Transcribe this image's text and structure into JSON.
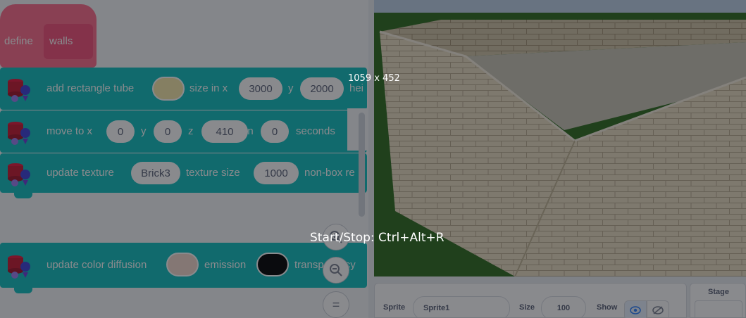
{
  "define_block": {
    "define_label": "define",
    "name_label": "walls"
  },
  "blocks": {
    "tube": {
      "label_add": "add rectangle tube",
      "label_size": "size in x",
      "x_value": "3000",
      "label_y": "y",
      "y_value": "2000",
      "label_tail": "hei",
      "color": "#f7e8a8"
    },
    "move": {
      "label_move": "move to x",
      "x_value": "0",
      "label_y": "y",
      "y_value": "0",
      "label_z": "z",
      "z_value": "410",
      "label_in": "in",
      "secs_value": "0",
      "label_seconds": "seconds"
    },
    "texture": {
      "label_update": "update texture",
      "texture_value": "Brick3",
      "label_size": "texture size",
      "size_value": "1000",
      "label_tail": "non-box re"
    },
    "color": {
      "label_update": "update color diffusion",
      "label_emission": "emission",
      "label_tail": "transparency",
      "diffusion_color": "#f5d8cc",
      "emission_color": "#000000"
    }
  },
  "zoom": {
    "zoom_in_icon": "zoom-in-icon",
    "zoom_out_icon": "zoom-out-icon",
    "reset_icon": "="
  },
  "sprite_panel": {
    "sprite_label": "Sprite",
    "sprite_name": "Sprite1",
    "size_label": "Size",
    "size_value": "100",
    "show_label": "Show"
  },
  "stage_panel": {
    "title": "Stage"
  },
  "overlay": {
    "dimensions": "1059 x 452",
    "hint": "Start/Stop: Ctrl+Alt+R"
  },
  "colors": {
    "block": "#0fbfbf",
    "define": "#ff6b8a",
    "stage_ground": "#2d6b1d",
    "brick": "#e8dcc0"
  }
}
